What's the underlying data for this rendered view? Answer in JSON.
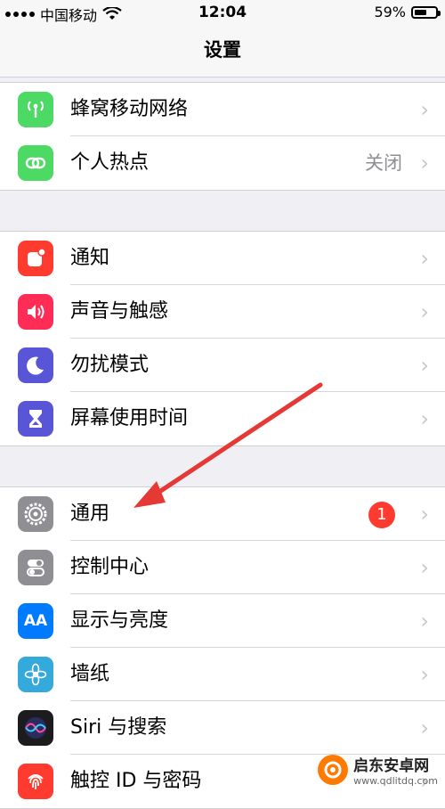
{
  "status": {
    "carrier": "中国移动",
    "time": "12:04",
    "battery_text": "59%",
    "battery_level": 0.59
  },
  "nav": {
    "title": "设置"
  },
  "groups": [
    {
      "items": [
        {
          "label": "蜂窝移动网络",
          "icon": "cellular-antenna-icon",
          "color": "#4cd964"
        },
        {
          "label": "个人热点",
          "icon": "hotspot-link-icon",
          "color": "#4cd964",
          "detail": "关闭"
        }
      ]
    },
    {
      "items": [
        {
          "label": "通知",
          "icon": "notification-icon",
          "color": "#ff3b30"
        },
        {
          "label": "声音与触感",
          "icon": "speaker-icon",
          "color": "#ff2d55"
        },
        {
          "label": "勿扰模式",
          "icon": "moon-icon",
          "color": "#5856d6"
        },
        {
          "label": "屏幕使用时间",
          "icon": "hourglass-icon",
          "color": "#5856d6"
        }
      ]
    },
    {
      "items": [
        {
          "label": "通用",
          "icon": "gear-icon",
          "color": "#8e8e93",
          "badge": "1"
        },
        {
          "label": "控制中心",
          "icon": "toggle-switches-icon",
          "color": "#8e8e93"
        },
        {
          "label": "显示与亮度",
          "icon": "text-size-icon",
          "color": "#007aff",
          "icon_text": "AA"
        },
        {
          "label": "墙纸",
          "icon": "flower-icon",
          "color": "#34aadc"
        },
        {
          "label": "Siri 与搜索",
          "icon": "siri-icon",
          "color": "#1c1c1e"
        },
        {
          "label": "触控 ID 与密码",
          "icon": "fingerprint-icon",
          "color": "#ff3b30"
        }
      ]
    }
  ],
  "chevron": "›",
  "watermark": {
    "name": "启东安卓网",
    "url": "www.qdlitdq.com"
  }
}
